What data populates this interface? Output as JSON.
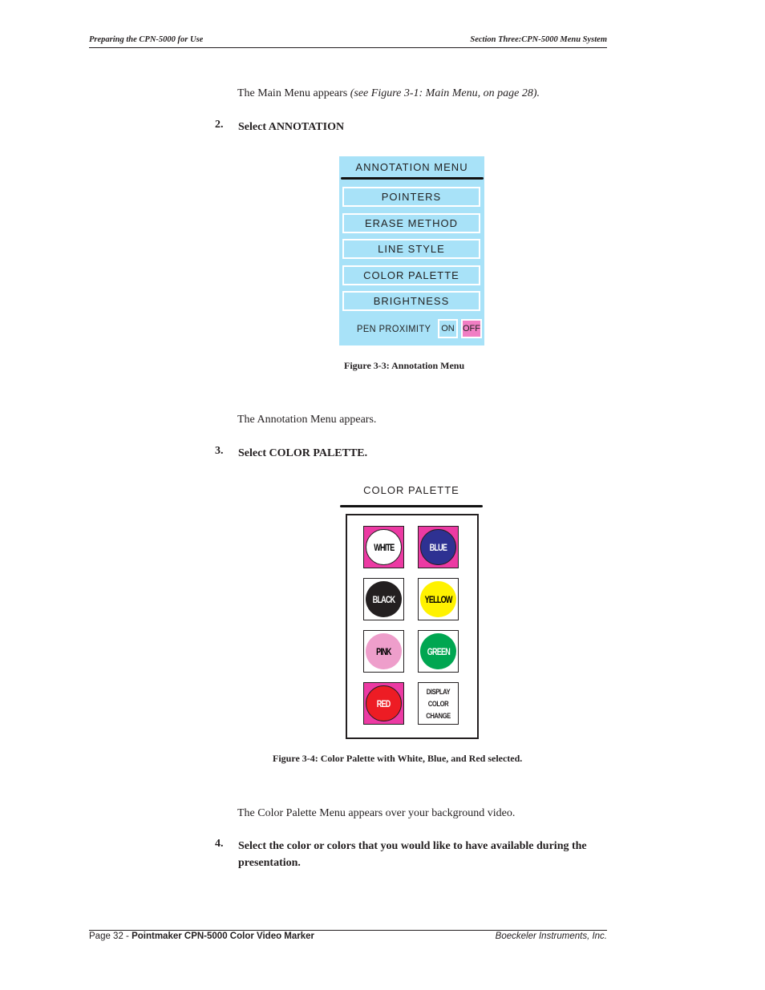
{
  "header": {
    "left": "Preparing the CPN-5000 for Use",
    "right": "Section Three:CPN-5000 Menu System"
  },
  "body": {
    "para1_plain": "The Main Menu appears ",
    "para1_italic": "(see Figure 3-1: Main Menu, on page 28).",
    "step2": {
      "num": "2.",
      "text": "Select ANNOTATION"
    },
    "para2": "The Annotation Menu appears.",
    "step3": {
      "num": "3.",
      "text": "Select COLOR PALETTE."
    },
    "para3": "The Color Palette Menu appears over your background video.",
    "step4": {
      "num": "4.",
      "text": "Select the color or colors that you would like to have available during the presentation."
    }
  },
  "annotation_menu": {
    "title": "ANNOTATION MENU",
    "items": [
      "POINTERS",
      "ERASE METHOD",
      "LINE STYLE",
      "COLOR PALETTE",
      "BRIGHTNESS"
    ],
    "pen_proximity": {
      "label": "PEN PROXIMITY",
      "on": "ON",
      "off": "OFF",
      "selected": "OFF"
    },
    "caption": "Figure 3-3:  Annotation Menu"
  },
  "color_palette": {
    "title": "COLOR PALETTE",
    "swatches": [
      {
        "label": "WHITE",
        "color": "#ffffff",
        "text_color": "#000000",
        "selected": true
      },
      {
        "label": "BLUE",
        "color": "#2e3192",
        "text_color": "#ffffff",
        "selected": true
      },
      {
        "label": "BLACK",
        "color": "#231f20",
        "text_color": "#ffffff",
        "selected": false
      },
      {
        "label": "YELLOW",
        "color": "#fff200",
        "text_color": "#000000",
        "selected": false
      },
      {
        "label": "PINK",
        "color": "#ee9ecb",
        "text_color": "#000000",
        "selected": false
      },
      {
        "label": "GREEN",
        "color": "#00a651",
        "text_color": "#ffffff",
        "selected": false
      },
      {
        "label": "RED",
        "color": "#ed1c24",
        "text_color": "#ffffff",
        "selected": true
      }
    ],
    "display_change": [
      "DISPLAY",
      "COLOR",
      "CHANGE"
    ],
    "caption": "Figure 3-4:   Color Palette with White, Blue, and Red selected.",
    "selected_color": "#ec3aa3"
  },
  "footer": {
    "page": "Page 32 - ",
    "title": "Pointmaker CPN-5000 Color Video Marker",
    "company": "Boeckeler Instruments, Inc."
  }
}
